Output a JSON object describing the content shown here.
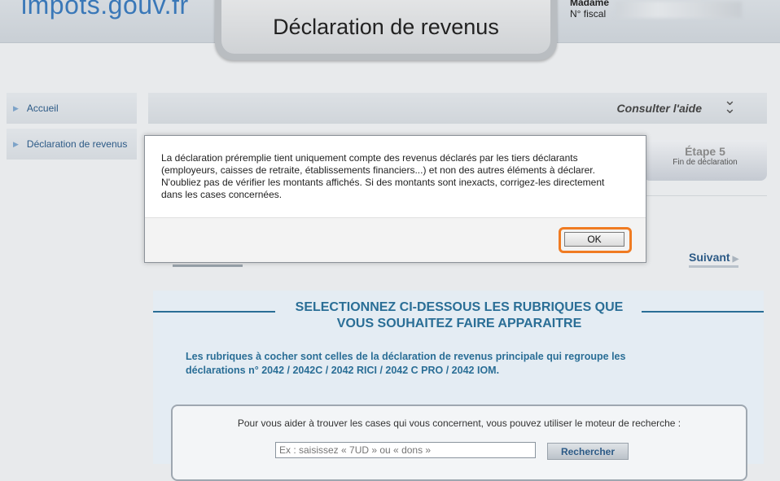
{
  "header": {
    "logo": "impots.gouv.fr",
    "title": "Déclaration de revenus",
    "user_title": "Madame",
    "fiscal_label": "N° fiscal"
  },
  "sidebar": {
    "items": [
      {
        "label": "Accueil"
      },
      {
        "label": "Déclaration de revenus"
      }
    ]
  },
  "aide": {
    "label": "Consulter l'aide"
  },
  "step": {
    "title": "Étape 5",
    "subtitle": "Fin de déclaration"
  },
  "nav": {
    "next_label": "Suivant"
  },
  "section": {
    "title_line1": "SELECTIONNEZ CI-DESSOUS LES RUBRIQUES QUE",
    "title_line2": "VOUS SOUHAITEZ FAIRE APPARAITRE",
    "description": "Les rubriques à cocher sont celles de la déclaration de revenus principale qui regroupe les déclarations n° 2042 / 2042C / 2042 RICI / 2042 C PRO / 2042 IOM.",
    "search_label": "Pour vous aider à trouver les cases qui vous concernent, vous pouvez utiliser le moteur de recherche :",
    "search_placeholder": "Ex : saisissez « 7UD » ou « dons »",
    "search_button": "Rechercher"
  },
  "modal": {
    "message": "La déclaration préremplie tient uniquement compte des revenus déclarés par les tiers déclarants (employeurs, caisses de retraite, établissements financiers...) et non des autres éléments à déclarer. N'oubliez pas de vérifier les montants affichés. Si des montants sont inexacts, corrigez-les directement dans les cases concernées.",
    "ok_label": "OK"
  },
  "colors": {
    "accent": "#2a6e96",
    "highlight": "#f07b22"
  }
}
